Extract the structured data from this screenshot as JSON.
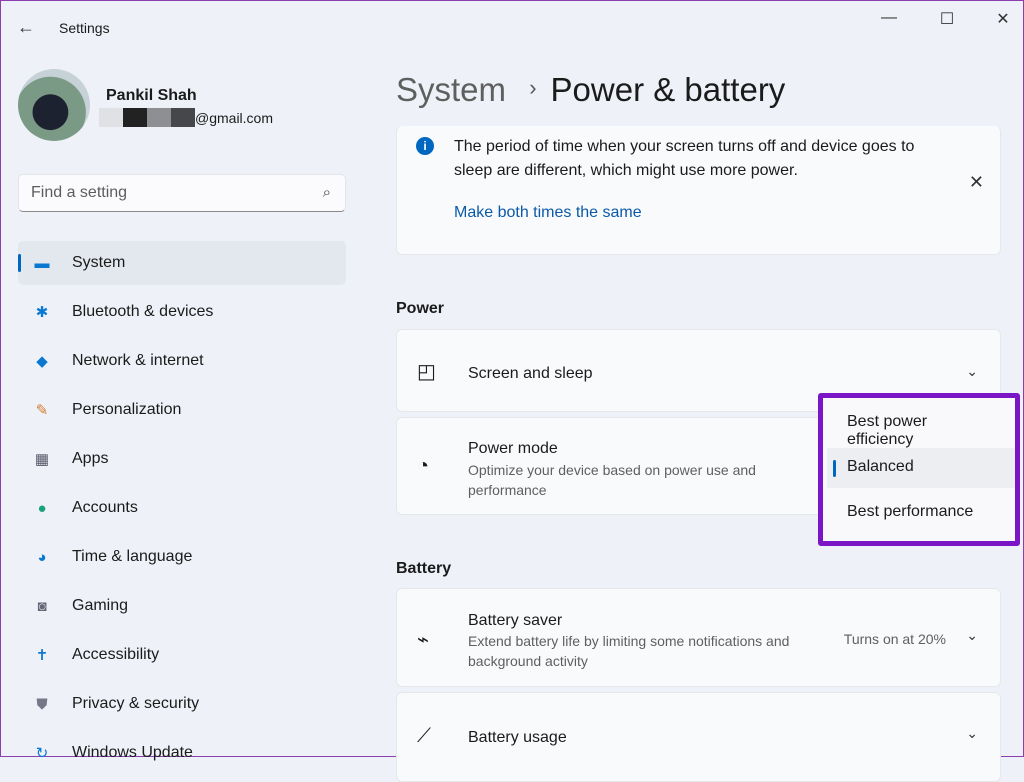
{
  "window": {
    "title": "Settings"
  },
  "user": {
    "name": "Pankil Shah",
    "email_suffix": "@gmail.com"
  },
  "search": {
    "placeholder": "Find a setting"
  },
  "sidebar": {
    "items": [
      {
        "label": "System",
        "icon": "monitor-icon"
      },
      {
        "label": "Bluetooth & devices",
        "icon": "bluetooth-icon"
      },
      {
        "label": "Network & internet",
        "icon": "wifi-icon"
      },
      {
        "label": "Personalization",
        "icon": "brush-icon"
      },
      {
        "label": "Apps",
        "icon": "apps-icon"
      },
      {
        "label": "Accounts",
        "icon": "person-icon"
      },
      {
        "label": "Time & language",
        "icon": "globe-clock-icon"
      },
      {
        "label": "Gaming",
        "icon": "gamepad-icon"
      },
      {
        "label": "Accessibility",
        "icon": "accessibility-icon"
      },
      {
        "label": "Privacy & security",
        "icon": "shield-icon"
      },
      {
        "label": "Windows Update",
        "icon": "update-icon"
      }
    ]
  },
  "breadcrumb": {
    "parent": "System",
    "sep": "›",
    "current": "Power & battery"
  },
  "info": {
    "text": "The period of time when your screen turns off and device goes to sleep are different, which might use more power.",
    "link": "Make both times the same"
  },
  "power": {
    "header": "Power",
    "screen_sleep": "Screen and sleep",
    "power_mode": "Power mode",
    "power_mode_desc": "Optimize your device based on power use and performance"
  },
  "power_mode_menu": {
    "options": [
      "Best power efficiency",
      "Balanced",
      "Best performance"
    ],
    "selected": "Balanced"
  },
  "battery": {
    "header": "Battery",
    "saver": "Battery saver",
    "saver_desc": "Extend battery life by limiting some notifications and background activity",
    "saver_status": "Turns on at 20%",
    "usage": "Battery usage"
  },
  "colors": {
    "accent": "#0067c0",
    "highlight": "#7a16c6"
  }
}
